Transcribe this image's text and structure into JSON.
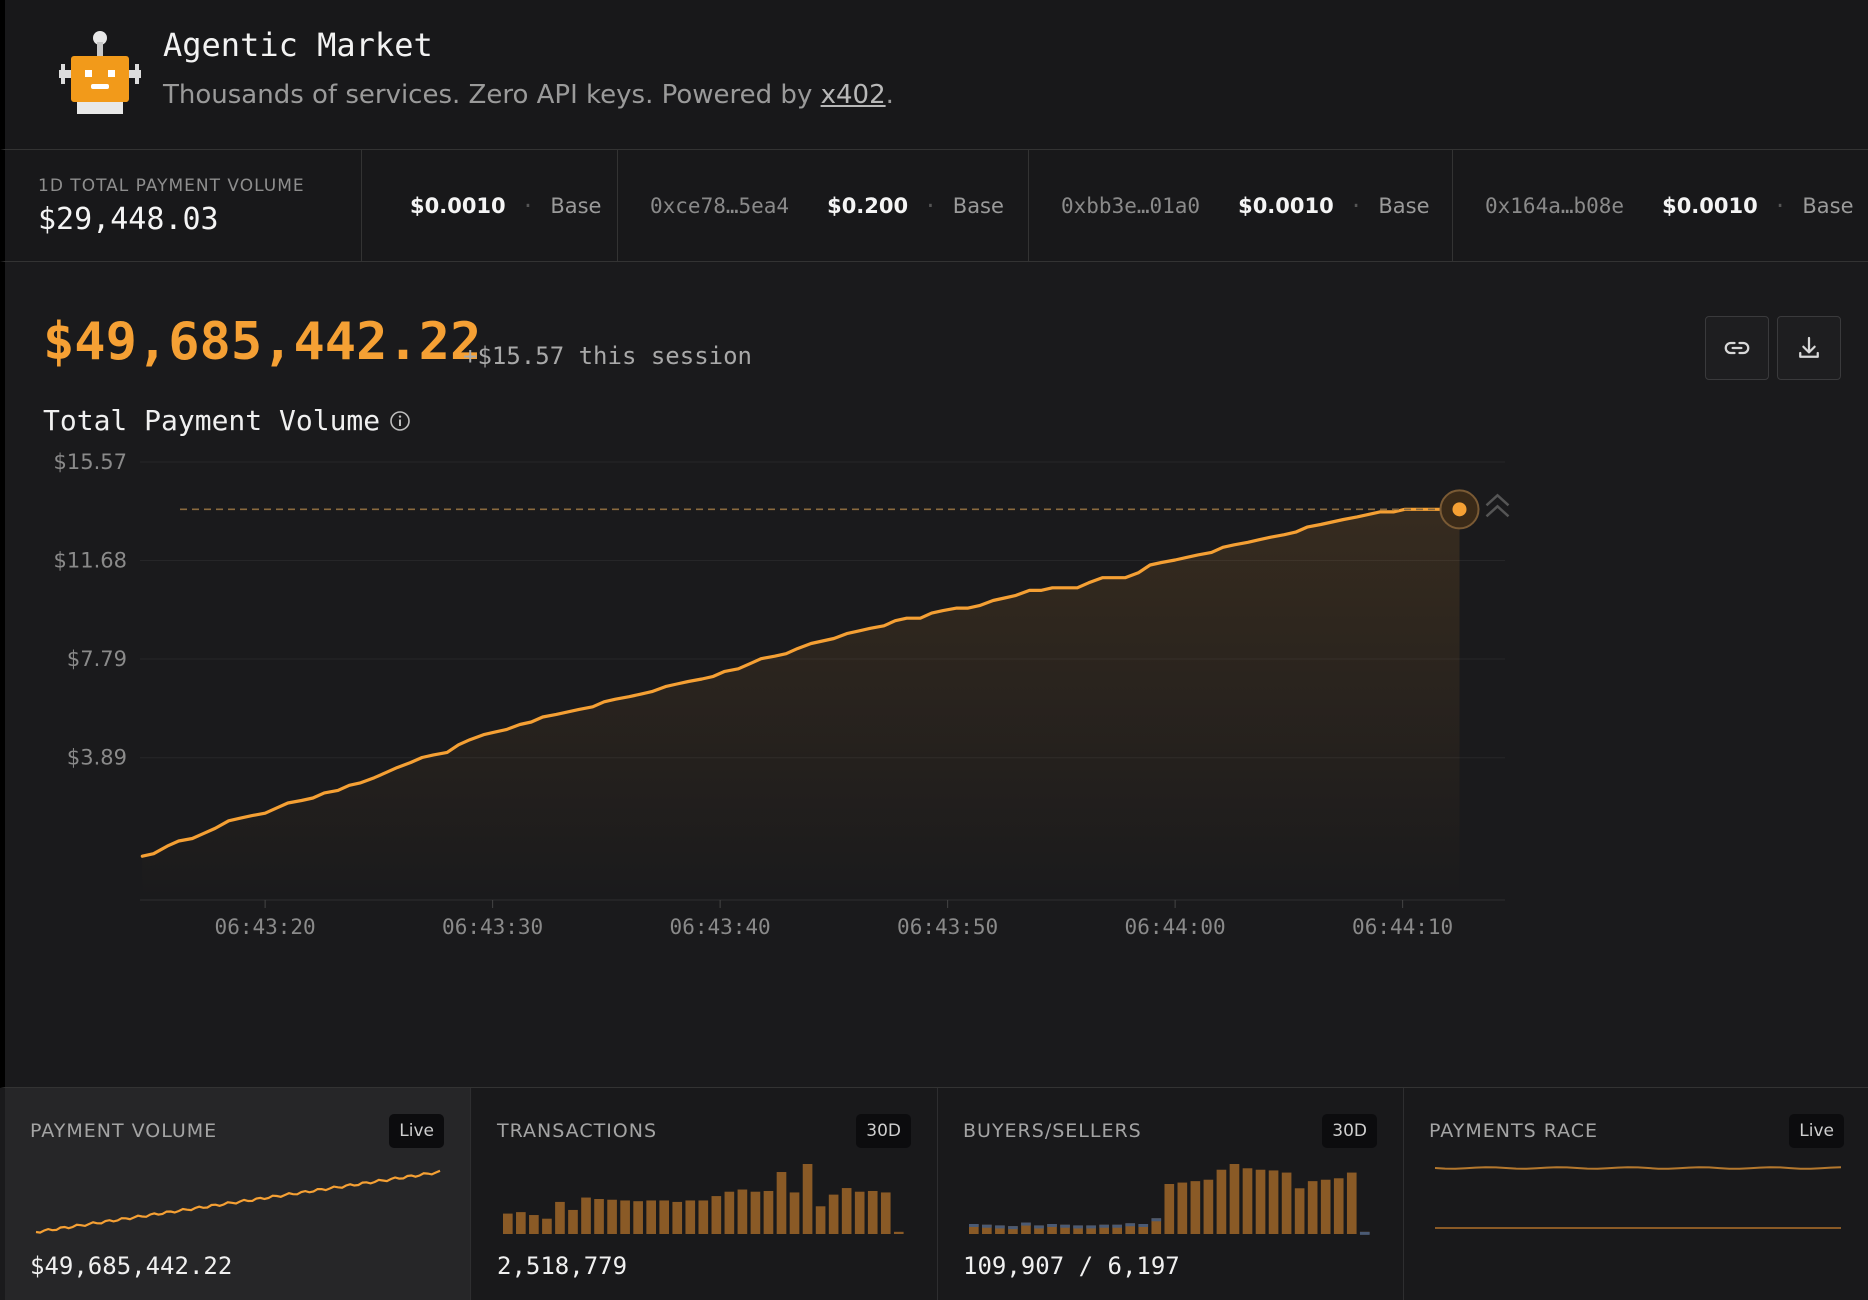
{
  "header": {
    "title": "Agentic Market",
    "subtitle_prefix": "Thousands of services. Zero API keys. Powered by ",
    "subtitle_link": "x402",
    "subtitle_suffix": "."
  },
  "strip": {
    "volume_label": "1D TOTAL PAYMENT VOLUME",
    "volume_value": "$29,448.03",
    "ticker": [
      {
        "address": "",
        "amount": "$0.0010",
        "chain": "Base"
      },
      {
        "address": "0xce78…5ea4",
        "amount": "$0.200",
        "chain": "Base"
      },
      {
        "address": "0xbb3e…01a0",
        "amount": "$0.0010",
        "chain": "Base"
      },
      {
        "address": "0x164a…b08e",
        "amount": "$0.0010",
        "chain": "Base"
      }
    ]
  },
  "main": {
    "total": "$49,685,442.22",
    "session_delta": "+$15.57 this session",
    "chart_title": "Total Payment Volume",
    "link_icon": "link-icon",
    "download_icon": "download-icon"
  },
  "colors": {
    "accent": "#f5a034",
    "background": "#1a1a1c"
  },
  "chart_data": {
    "type": "line",
    "title": "Total Payment Volume",
    "xlabel": "",
    "ylabel": "",
    "y_ticks": [
      "$3.89",
      "$7.79",
      "$11.68",
      "$15.57"
    ],
    "y_tick_values": [
      3.89,
      7.79,
      11.68,
      15.57
    ],
    "x_ticks": [
      "06:43:20",
      "06:43:30",
      "06:43:40",
      "06:43:50",
      "06:44:00",
      "06:44:10"
    ],
    "x_tick_seconds": [
      20,
      30,
      40,
      50,
      60,
      70
    ],
    "xlim_seconds": [
      14.5,
      74.5
    ],
    "ylim": [
      -1.73,
      15.57
    ],
    "grid": true,
    "series": [
      {
        "x_seconds": [
          14.6,
          15.1,
          15.7,
          16.2,
          16.8,
          17.3,
          17.8,
          18.4,
          18.9,
          19.4,
          20.0,
          20.5,
          21.0,
          21.6,
          22.1,
          22.6,
          23.2,
          23.7,
          24.2,
          24.8,
          25.3,
          25.8,
          26.4,
          26.9,
          27.4,
          28.0,
          28.5,
          29.0,
          29.6,
          30.1,
          30.6,
          31.2,
          31.7,
          32.2,
          32.8,
          33.3,
          33.8,
          34.4,
          34.9,
          35.4,
          36.0,
          36.5,
          37.0,
          37.6,
          38.1,
          38.6,
          39.2,
          39.7,
          40.2,
          40.8,
          41.3,
          41.8,
          42.4,
          42.9,
          43.4,
          44.0,
          44.5,
          45.0,
          45.6,
          46.1,
          46.6,
          47.2,
          47.7,
          48.2,
          48.8,
          49.3,
          49.8,
          50.4,
          50.9,
          51.4,
          52.0,
          52.5,
          53.0,
          53.6,
          54.1,
          54.6,
          55.2,
          55.7,
          56.2,
          56.8,
          57.3,
          57.8,
          58.4,
          58.9,
          59.4,
          60.0,
          60.5,
          61.0,
          61.6,
          62.1,
          62.6,
          63.2,
          63.7,
          64.2,
          64.8,
          65.3,
          65.8,
          66.4,
          66.9,
          67.4,
          68.0,
          68.5,
          69.0,
          69.6,
          70.1,
          70.6,
          71.2,
          71.7,
          72.2,
          72.5
        ],
        "values": [
          0.0,
          0.1,
          0.4,
          0.6,
          0.7,
          0.9,
          1.1,
          1.4,
          1.5,
          1.6,
          1.7,
          1.9,
          2.1,
          2.2,
          2.3,
          2.5,
          2.6,
          2.8,
          2.9,
          3.1,
          3.3,
          3.5,
          3.7,
          3.9,
          4.0,
          4.1,
          4.4,
          4.6,
          4.8,
          4.9,
          5.0,
          5.2,
          5.3,
          5.5,
          5.6,
          5.7,
          5.8,
          5.9,
          6.1,
          6.2,
          6.3,
          6.4,
          6.5,
          6.7,
          6.8,
          6.9,
          7.0,
          7.1,
          7.3,
          7.4,
          7.6,
          7.8,
          7.9,
          8.0,
          8.2,
          8.4,
          8.5,
          8.6,
          8.8,
          8.9,
          9.0,
          9.1,
          9.3,
          9.4,
          9.4,
          9.6,
          9.7,
          9.8,
          9.8,
          9.9,
          10.1,
          10.2,
          10.3,
          10.5,
          10.5,
          10.6,
          10.6,
          10.6,
          10.8,
          11.0,
          11.0,
          11.0,
          11.2,
          11.5,
          11.6,
          11.7,
          11.8,
          11.9,
          12.0,
          12.2,
          12.3,
          12.4,
          12.5,
          12.6,
          12.7,
          12.8,
          13.0,
          13.1,
          13.2,
          13.3,
          13.4,
          13.5,
          13.6,
          13.6,
          13.7,
          13.7,
          13.7,
          13.7,
          13.7,
          13.7
        ],
        "current_value": 13.7
      }
    ]
  },
  "cards": [
    {
      "label": "PAYMENT VOLUME",
      "badge": "Live",
      "value": "$49,685,442.22",
      "spark_values": [
        0,
        1,
        2,
        3,
        4,
        5,
        6,
        7,
        8,
        9,
        10,
        11,
        12,
        13,
        14,
        15,
        16,
        17,
        18,
        19,
        20,
        21,
        22,
        23,
        24,
        25,
        26,
        27,
        28,
        29,
        30,
        31,
        32,
        33,
        34,
        35,
        36,
        37,
        38,
        39,
        40,
        41,
        42,
        43,
        44,
        45,
        46,
        47,
        48,
        49,
        50,
        51,
        52,
        53,
        54,
        55,
        56,
        57,
        58,
        59,
        60,
        61,
        62,
        63,
        64,
        65,
        66,
        67,
        68,
        69,
        70,
        71,
        72,
        73,
        74,
        75,
        76,
        77,
        78,
        79,
        80,
        81,
        82,
        83,
        84,
        85,
        86,
        87,
        88,
        89,
        90,
        91,
        92,
        93,
        94,
        95,
        96,
        97,
        98,
        99
      ]
    },
    {
      "label": "TRANSACTIONS",
      "badge": "30D",
      "value": "2,518,779",
      "bars": [
        28,
        30,
        26,
        21,
        44,
        33,
        50,
        48,
        47,
        46,
        45,
        46,
        46,
        44,
        46,
        46,
        52,
        58,
        61,
        58,
        59,
        85,
        57,
        96,
        38,
        54,
        63,
        58,
        59,
        57,
        3
      ]
    },
    {
      "label": "BUYERS/SELLERS",
      "badge": "30D",
      "value": "109,907 / 6,197",
      "bars": [
        14,
        13,
        12,
        11,
        16,
        12,
        14,
        13,
        12,
        12,
        13,
        13,
        15,
        14,
        22,
        70,
        72,
        74,
        76,
        90,
        98,
        92,
        90,
        89,
        86,
        64,
        74,
        76,
        78,
        86,
        3
      ]
    },
    {
      "label": "PAYMENTS RACE",
      "badge": "Live",
      "value": ""
    }
  ]
}
